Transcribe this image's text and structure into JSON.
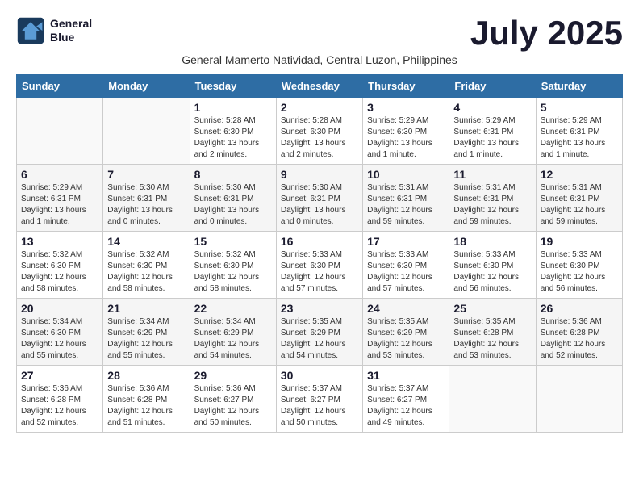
{
  "header": {
    "logo_line1": "General",
    "logo_line2": "Blue",
    "month_title": "July 2025",
    "subtitle": "General Mamerto Natividad, Central Luzon, Philippines"
  },
  "days_of_week": [
    "Sunday",
    "Monday",
    "Tuesday",
    "Wednesday",
    "Thursday",
    "Friday",
    "Saturday"
  ],
  "weeks": [
    [
      {
        "day": "",
        "info": ""
      },
      {
        "day": "",
        "info": ""
      },
      {
        "day": "1",
        "info": "Sunrise: 5:28 AM\nSunset: 6:30 PM\nDaylight: 13 hours and 2 minutes."
      },
      {
        "day": "2",
        "info": "Sunrise: 5:28 AM\nSunset: 6:30 PM\nDaylight: 13 hours and 2 minutes."
      },
      {
        "day": "3",
        "info": "Sunrise: 5:29 AM\nSunset: 6:30 PM\nDaylight: 13 hours and 1 minute."
      },
      {
        "day": "4",
        "info": "Sunrise: 5:29 AM\nSunset: 6:31 PM\nDaylight: 13 hours and 1 minute."
      },
      {
        "day": "5",
        "info": "Sunrise: 5:29 AM\nSunset: 6:31 PM\nDaylight: 13 hours and 1 minute."
      }
    ],
    [
      {
        "day": "6",
        "info": "Sunrise: 5:29 AM\nSunset: 6:31 PM\nDaylight: 13 hours and 1 minute."
      },
      {
        "day": "7",
        "info": "Sunrise: 5:30 AM\nSunset: 6:31 PM\nDaylight: 13 hours and 0 minutes."
      },
      {
        "day": "8",
        "info": "Sunrise: 5:30 AM\nSunset: 6:31 PM\nDaylight: 13 hours and 0 minutes."
      },
      {
        "day": "9",
        "info": "Sunrise: 5:30 AM\nSunset: 6:31 PM\nDaylight: 13 hours and 0 minutes."
      },
      {
        "day": "10",
        "info": "Sunrise: 5:31 AM\nSunset: 6:31 PM\nDaylight: 12 hours and 59 minutes."
      },
      {
        "day": "11",
        "info": "Sunrise: 5:31 AM\nSunset: 6:31 PM\nDaylight: 12 hours and 59 minutes."
      },
      {
        "day": "12",
        "info": "Sunrise: 5:31 AM\nSunset: 6:31 PM\nDaylight: 12 hours and 59 minutes."
      }
    ],
    [
      {
        "day": "13",
        "info": "Sunrise: 5:32 AM\nSunset: 6:30 PM\nDaylight: 12 hours and 58 minutes."
      },
      {
        "day": "14",
        "info": "Sunrise: 5:32 AM\nSunset: 6:30 PM\nDaylight: 12 hours and 58 minutes."
      },
      {
        "day": "15",
        "info": "Sunrise: 5:32 AM\nSunset: 6:30 PM\nDaylight: 12 hours and 58 minutes."
      },
      {
        "day": "16",
        "info": "Sunrise: 5:33 AM\nSunset: 6:30 PM\nDaylight: 12 hours and 57 minutes."
      },
      {
        "day": "17",
        "info": "Sunrise: 5:33 AM\nSunset: 6:30 PM\nDaylight: 12 hours and 57 minutes."
      },
      {
        "day": "18",
        "info": "Sunrise: 5:33 AM\nSunset: 6:30 PM\nDaylight: 12 hours and 56 minutes."
      },
      {
        "day": "19",
        "info": "Sunrise: 5:33 AM\nSunset: 6:30 PM\nDaylight: 12 hours and 56 minutes."
      }
    ],
    [
      {
        "day": "20",
        "info": "Sunrise: 5:34 AM\nSunset: 6:30 PM\nDaylight: 12 hours and 55 minutes."
      },
      {
        "day": "21",
        "info": "Sunrise: 5:34 AM\nSunset: 6:29 PM\nDaylight: 12 hours and 55 minutes."
      },
      {
        "day": "22",
        "info": "Sunrise: 5:34 AM\nSunset: 6:29 PM\nDaylight: 12 hours and 54 minutes."
      },
      {
        "day": "23",
        "info": "Sunrise: 5:35 AM\nSunset: 6:29 PM\nDaylight: 12 hours and 54 minutes."
      },
      {
        "day": "24",
        "info": "Sunrise: 5:35 AM\nSunset: 6:29 PM\nDaylight: 12 hours and 53 minutes."
      },
      {
        "day": "25",
        "info": "Sunrise: 5:35 AM\nSunset: 6:28 PM\nDaylight: 12 hours and 53 minutes."
      },
      {
        "day": "26",
        "info": "Sunrise: 5:36 AM\nSunset: 6:28 PM\nDaylight: 12 hours and 52 minutes."
      }
    ],
    [
      {
        "day": "27",
        "info": "Sunrise: 5:36 AM\nSunset: 6:28 PM\nDaylight: 12 hours and 52 minutes."
      },
      {
        "day": "28",
        "info": "Sunrise: 5:36 AM\nSunset: 6:28 PM\nDaylight: 12 hours and 51 minutes."
      },
      {
        "day": "29",
        "info": "Sunrise: 5:36 AM\nSunset: 6:27 PM\nDaylight: 12 hours and 50 minutes."
      },
      {
        "day": "30",
        "info": "Sunrise: 5:37 AM\nSunset: 6:27 PM\nDaylight: 12 hours and 50 minutes."
      },
      {
        "day": "31",
        "info": "Sunrise: 5:37 AM\nSunset: 6:27 PM\nDaylight: 12 hours and 49 minutes."
      },
      {
        "day": "",
        "info": ""
      },
      {
        "day": "",
        "info": ""
      }
    ]
  ]
}
